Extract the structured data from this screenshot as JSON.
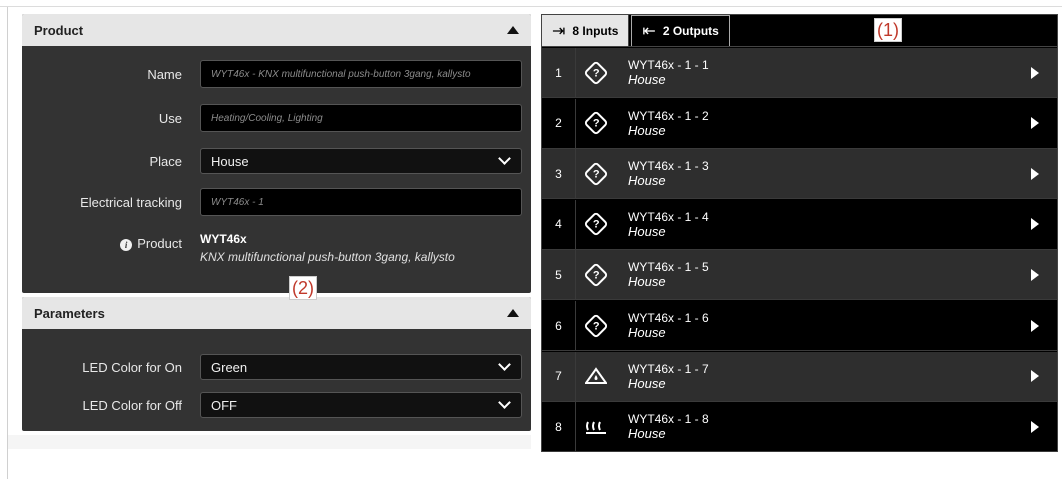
{
  "product_panel": {
    "title": "Product",
    "name_label": "Name",
    "name_value": "WYT46x - KNX multifunctional push-button 3gang, kallysto",
    "use_label": "Use",
    "use_value": "Heating/Cooling, Lighting",
    "place_label": "Place",
    "place_value": "House",
    "tracking_label": "Electrical tracking",
    "tracking_value": "WYT46x - 1",
    "product_label": "Product",
    "product_code": "WYT46x",
    "product_desc": "KNX multifunctional push-button 3gang, kallysto"
  },
  "params_panel": {
    "title": "Parameters",
    "led_on_label": "LED Color for On",
    "led_on_value": "Green",
    "led_off_label": "LED Color for Off",
    "led_off_value": "OFF"
  },
  "markers": {
    "m1": "(1)",
    "m2": "(2)"
  },
  "tabs": {
    "inputs": "8 Inputs",
    "outputs": "2 Outputs"
  },
  "rows": [
    {
      "index": "1",
      "name": "WYT46x - 1 - 1",
      "place": "House",
      "icon": "question-diamond-icon"
    },
    {
      "index": "2",
      "name": "WYT46x - 1 - 2",
      "place": "House",
      "icon": "question-diamond-icon"
    },
    {
      "index": "3",
      "name": "WYT46x - 1 - 3",
      "place": "House",
      "icon": "question-diamond-icon"
    },
    {
      "index": "4",
      "name": "WYT46x - 1 - 4",
      "place": "House",
      "icon": "question-diamond-icon"
    },
    {
      "index": "5",
      "name": "WYT46x - 1 - 5",
      "place": "House",
      "icon": "question-diamond-icon"
    },
    {
      "index": "6",
      "name": "WYT46x - 1 - 6",
      "place": "House",
      "icon": "question-diamond-icon"
    },
    {
      "index": "7",
      "name": "WYT46x - 1 - 7",
      "place": "House",
      "icon": "house-drop-icon"
    },
    {
      "index": "8",
      "name": "WYT46x - 1 - 8",
      "place": "House",
      "icon": "heating-icon"
    }
  ]
}
